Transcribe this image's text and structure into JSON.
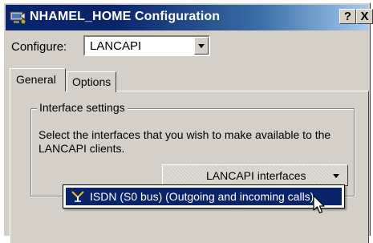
{
  "window": {
    "title": "NHAMEL_HOME Configuration",
    "help_button": "?",
    "close_button": "X"
  },
  "configure": {
    "label": "Configure:",
    "selected": "LANCAPI"
  },
  "tabs": [
    {
      "label": "General",
      "active": true
    },
    {
      "label": "Options",
      "active": false
    }
  ],
  "interface_settings": {
    "legend": "Interface settings",
    "description": "Select the interfaces that you wish to make available to the LANCAPI clients.",
    "button_label": "LANCAPI interfaces"
  },
  "dropdown_menu": {
    "items": [
      {
        "label": "ISDN (S0 bus) (Outgoing and incoming calls)",
        "highlighted": true,
        "icon": "isdn-icon"
      }
    ]
  },
  "colors": {
    "titlebar_start": "#0a246a",
    "titlebar_end": "#a6caf0",
    "dialog_face": "#d4d0c8",
    "highlight": "#0a246a"
  }
}
